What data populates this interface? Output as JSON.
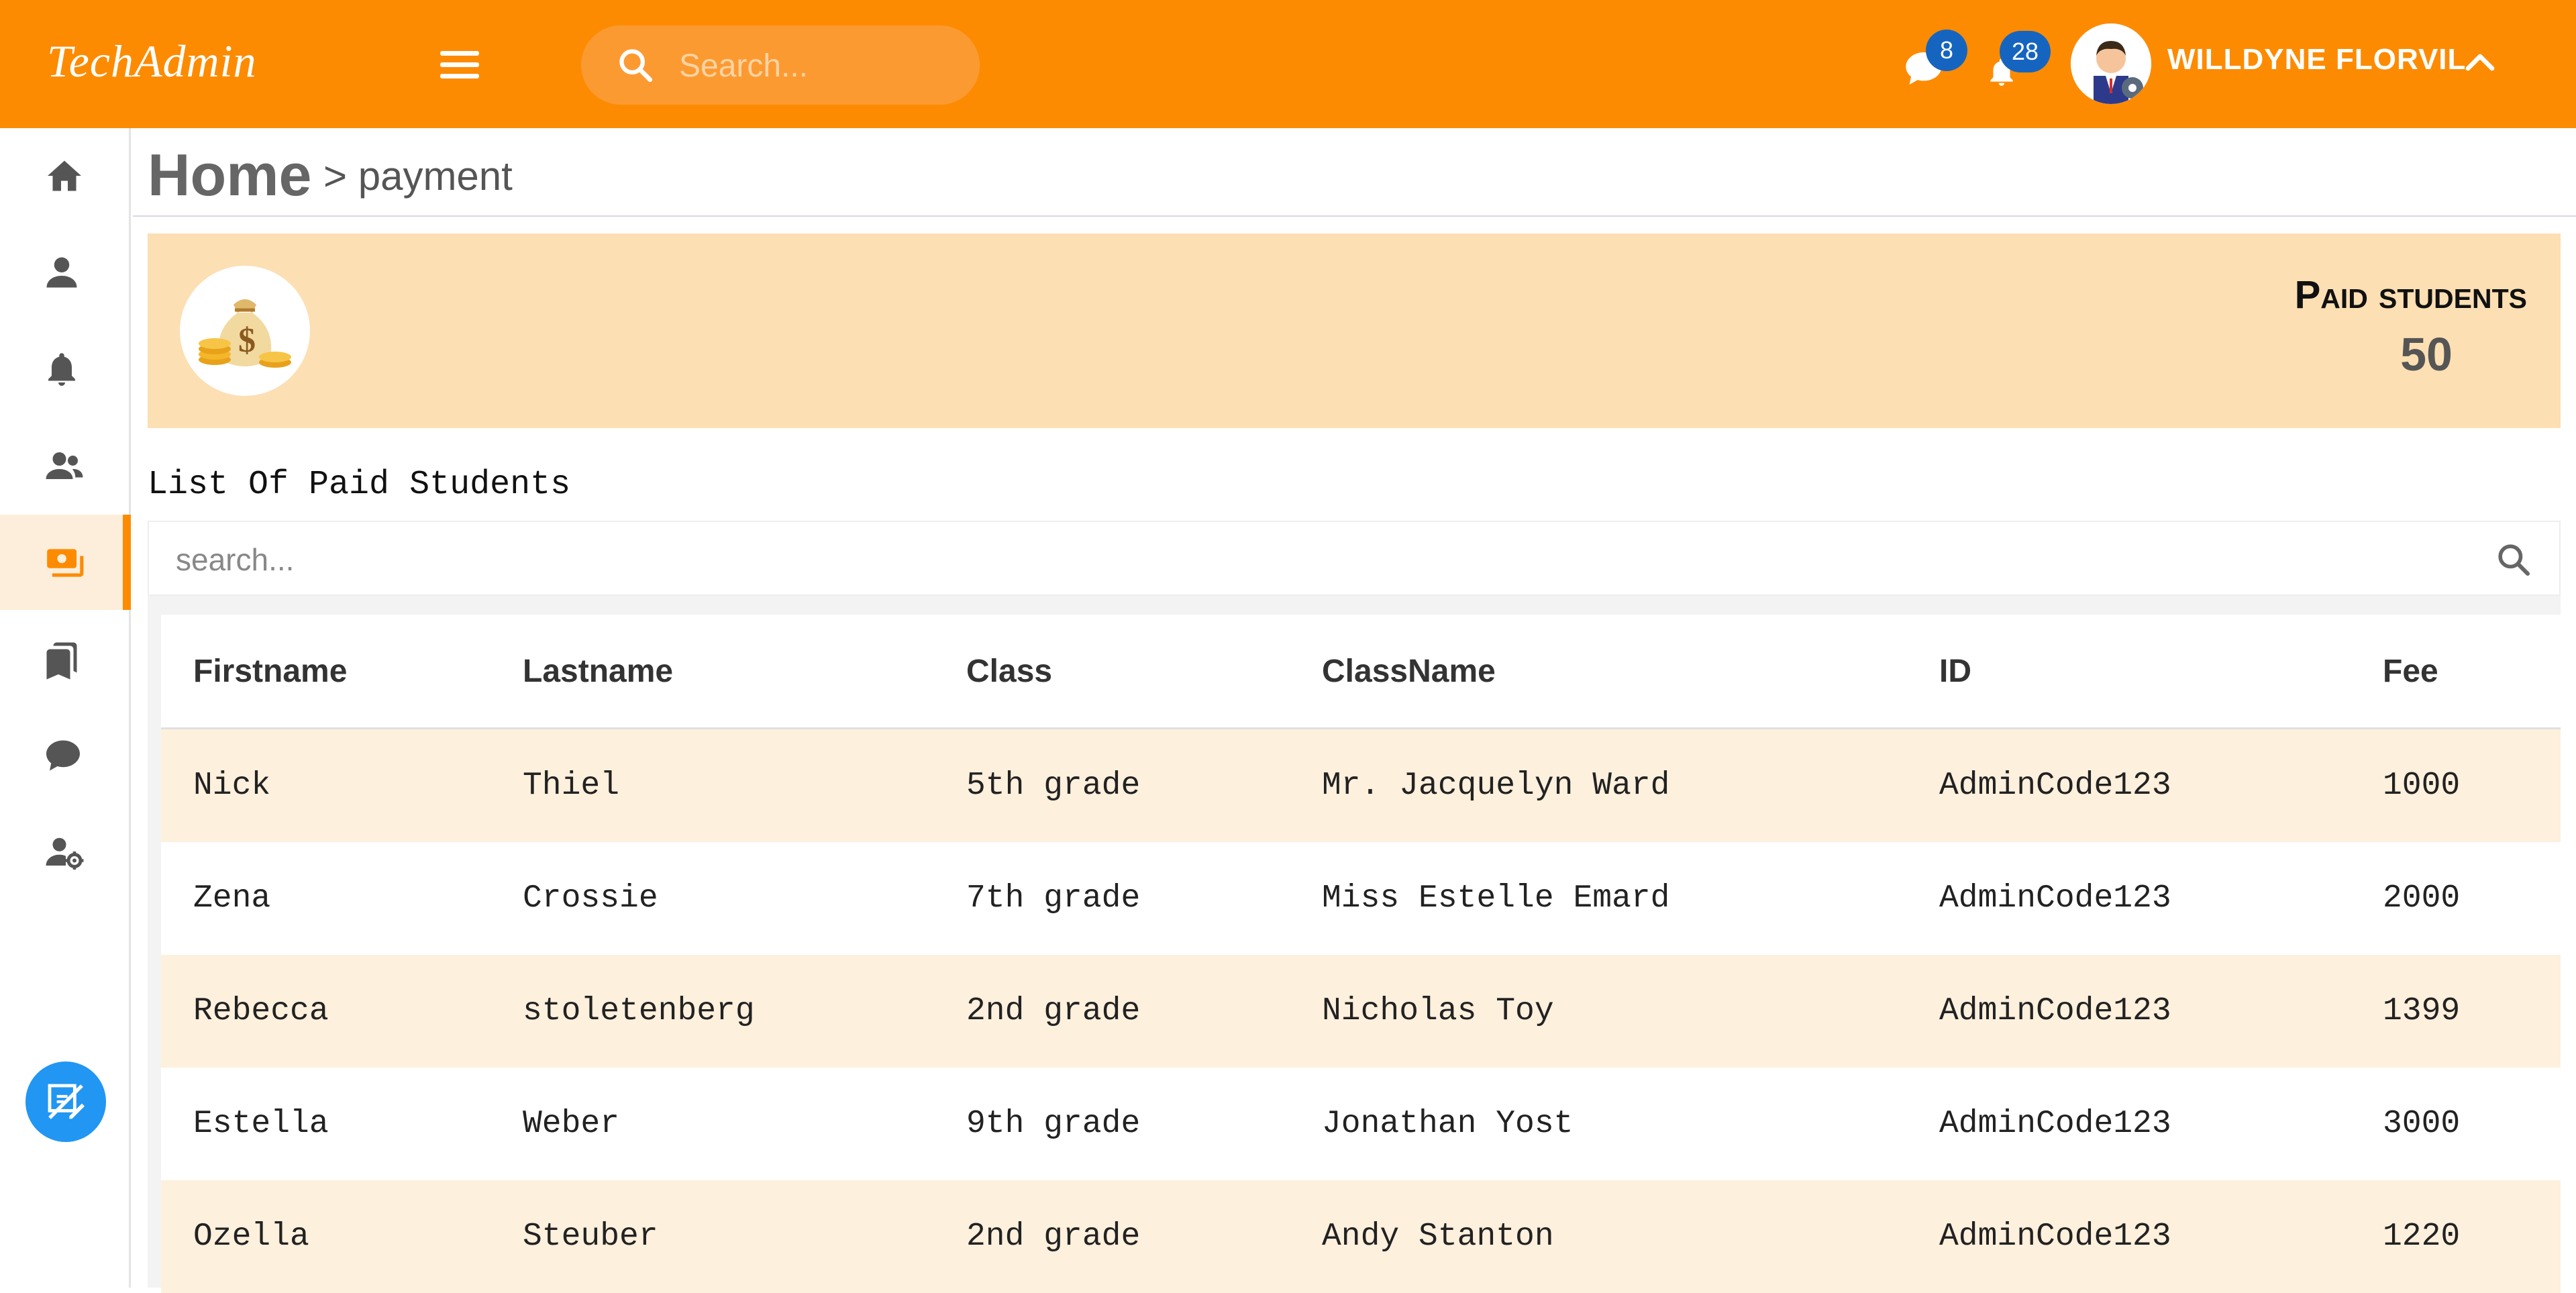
{
  "app": {
    "brand": "TechAdmin"
  },
  "header": {
    "search_placeholder": "Search...",
    "messages_count": "8",
    "notifications_count": "28",
    "user_name": "WILLDYNE FLORVIL"
  },
  "sidebar": {
    "items": [
      {
        "name": "home",
        "icon": "home-icon",
        "active": false
      },
      {
        "name": "profile",
        "icon": "person-icon",
        "active": false
      },
      {
        "name": "notifications",
        "icon": "bell-icon",
        "active": false
      },
      {
        "name": "students",
        "icon": "people-icon",
        "active": false
      },
      {
        "name": "payment",
        "icon": "payments-icon",
        "active": true
      },
      {
        "name": "library",
        "icon": "bookmarks-icon",
        "active": false
      },
      {
        "name": "chat",
        "icon": "chat-icon",
        "active": false
      },
      {
        "name": "admin-settings",
        "icon": "user-cog-icon",
        "active": false
      }
    ],
    "fab_icon": "edit-board-icon"
  },
  "breadcrumb": {
    "home": "Home",
    "current": "> payment"
  },
  "summary": {
    "label": "Paid students",
    "value": "50",
    "icon": "money-bag-icon"
  },
  "list": {
    "title": "List Of Paid Students",
    "search_placeholder": "search..."
  },
  "table": {
    "headers": [
      "Firstname",
      "Lastname",
      "Class",
      "ClassName",
      "ID",
      "Fee"
    ],
    "rows": [
      [
        "Nick",
        "Thiel",
        "5th grade",
        "Mr. Jacquelyn Ward",
        "AdminCode123",
        "1000"
      ],
      [
        "Zena",
        "Crossie",
        "7th grade",
        "Miss Estelle Emard",
        "AdminCode123",
        "2000"
      ],
      [
        "Rebecca",
        "stoletenberg",
        "2nd grade",
        "Nicholas Toy",
        "AdminCode123",
        "1399"
      ],
      [
        "Estella",
        "Weber",
        "9th grade",
        "Jonathan Yost",
        "AdminCode123",
        "3000"
      ],
      [
        "Ozella",
        "Steuber",
        "2nd grade",
        "Andy Stanton",
        "AdminCode123",
        "1220"
      ]
    ]
  },
  "colors": {
    "header_bg": "#fd8b02",
    "summary_bg": "#fcdfb3",
    "row_alt_bg": "#fdf0dd",
    "badge_bg": "#1565c0",
    "fab_bg": "#2196f3"
  }
}
